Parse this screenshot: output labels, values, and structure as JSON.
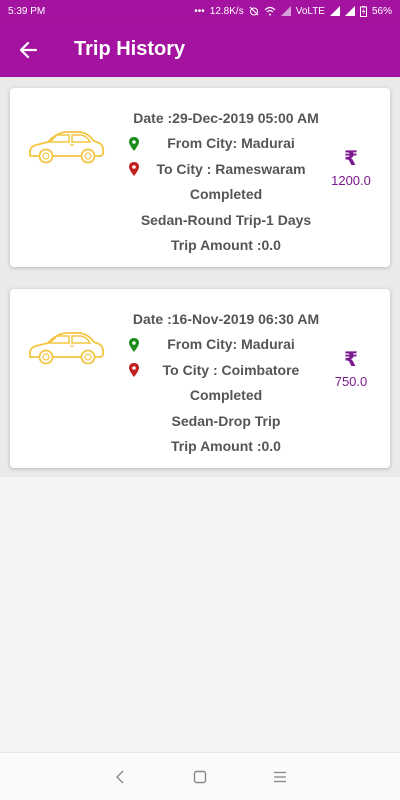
{
  "status_bar": {
    "time": "5:39 PM",
    "net_speed": "12.8K/s",
    "carrier": "VoLTE",
    "battery": "56%"
  },
  "app_bar": {
    "title": "Trip History"
  },
  "colors": {
    "accent": "#a4139f",
    "price": "#7b1a8f",
    "car": "#f4c542",
    "pin_green": "#1c8c1c",
    "pin_red": "#c0211f"
  },
  "trips": [
    {
      "date": "Date :29-Dec-2019 05:00 AM",
      "from": "From City: Madurai",
      "to": "To City : Rameswaram",
      "status": "Completed",
      "type": "Sedan-Round Trip-1 Days",
      "amount": "Trip Amount :0.0",
      "currency": "₹",
      "price": "1200.0"
    },
    {
      "date": "Date :16-Nov-2019 06:30 AM",
      "from": "From City: Madurai",
      "to": "To City : Coimbatore",
      "status": "Completed",
      "type": "Sedan-Drop Trip",
      "amount": "Trip Amount :0.0",
      "currency": "₹",
      "price": "750.0"
    }
  ]
}
